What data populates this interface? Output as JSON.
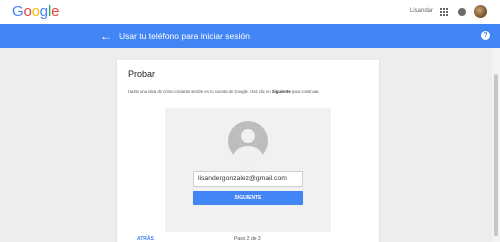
{
  "header": {
    "logo_letters": [
      "G",
      "o",
      "o",
      "g",
      "l",
      "e"
    ],
    "logo_colors": [
      "#4285f4",
      "#ea4335",
      "#fbbc05",
      "#4285f4",
      "#34a853",
      "#ea4335"
    ],
    "user_name": "Lisandar",
    "apps_icon": "apps-grid-icon",
    "notifications_icon": "notifications-icon"
  },
  "bluebar": {
    "back_icon": "←",
    "title": "Usar tu teléfono para iniciar sesión",
    "help_icon": "?"
  },
  "card": {
    "title": "Probar",
    "description_pre": "Hazte una idea de cómo iniciarás sesión en tu cuenta de Google. Haz clic en ",
    "description_bold": "Siguiente",
    "description_post": " para continuar.",
    "email_value": "lisandergonzalez@gmail.com",
    "next_label": "SIGUIENTE",
    "back_label": "ATRÁS",
    "step_text": "Paso 2 de 3"
  },
  "colors": {
    "accent": "#4285f4",
    "background": "#ededed"
  }
}
